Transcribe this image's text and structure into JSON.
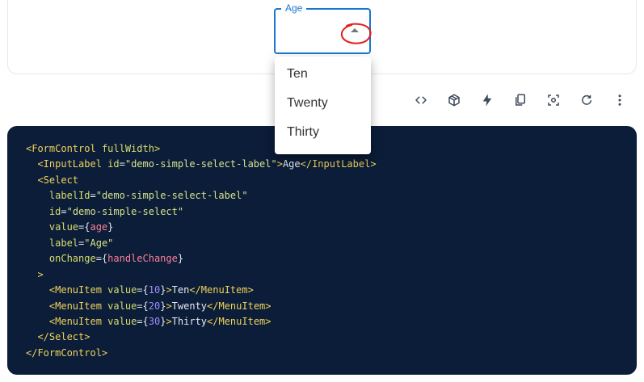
{
  "select": {
    "label": "Age",
    "options": [
      "Ten",
      "Twenty",
      "Thirty"
    ]
  },
  "toolbar": {
    "buttons": [
      {
        "name": "code-icon",
        "glyph": "<>"
      },
      {
        "name": "codesandbox-icon",
        "glyph": "cube"
      },
      {
        "name": "stackblitz-icon",
        "glyph": "bolt"
      },
      {
        "name": "copy-icon",
        "glyph": "copy"
      },
      {
        "name": "reset-focus-icon",
        "glyph": "focus"
      },
      {
        "name": "reset-demo-icon",
        "glyph": "refresh"
      },
      {
        "name": "more-options-icon",
        "glyph": "more"
      }
    ]
  },
  "code": {
    "lines": [
      [
        {
          "t": "tag",
          "v": "<FormControl"
        },
        {
          "t": "txt",
          "v": " "
        },
        {
          "t": "attr",
          "v": "fullWidth"
        },
        {
          "t": "tag",
          "v": ">"
        }
      ],
      [
        {
          "t": "txt",
          "v": "  "
        },
        {
          "t": "tag",
          "v": "<InputLabel"
        },
        {
          "t": "txt",
          "v": " "
        },
        {
          "t": "attr",
          "v": "id"
        },
        {
          "t": "punc",
          "v": "="
        },
        {
          "t": "str",
          "v": "\"demo-simple-select-label\""
        },
        {
          "t": "tag",
          "v": ">"
        },
        {
          "t": "txt",
          "v": "Age"
        },
        {
          "t": "tag",
          "v": "</InputLabel>"
        }
      ],
      [
        {
          "t": "txt",
          "v": "  "
        },
        {
          "t": "tag",
          "v": "<Select"
        }
      ],
      [
        {
          "t": "txt",
          "v": "    "
        },
        {
          "t": "attr",
          "v": "labelId"
        },
        {
          "t": "punc",
          "v": "="
        },
        {
          "t": "str",
          "v": "\"demo-simple-select-label\""
        }
      ],
      [
        {
          "t": "txt",
          "v": "    "
        },
        {
          "t": "attr",
          "v": "id"
        },
        {
          "t": "punc",
          "v": "="
        },
        {
          "t": "str",
          "v": "\"demo-simple-select\""
        }
      ],
      [
        {
          "t": "txt",
          "v": "    "
        },
        {
          "t": "attr",
          "v": "value"
        },
        {
          "t": "punc",
          "v": "={"
        },
        {
          "t": "var",
          "v": "age"
        },
        {
          "t": "punc",
          "v": "}"
        }
      ],
      [
        {
          "t": "txt",
          "v": "    "
        },
        {
          "t": "attr",
          "v": "label"
        },
        {
          "t": "punc",
          "v": "="
        },
        {
          "t": "str",
          "v": "\"Age\""
        }
      ],
      [
        {
          "t": "txt",
          "v": "    "
        },
        {
          "t": "attr",
          "v": "onChange"
        },
        {
          "t": "punc",
          "v": "={"
        },
        {
          "t": "var",
          "v": "handleChange"
        },
        {
          "t": "punc",
          "v": "}"
        }
      ],
      [
        {
          "t": "txt",
          "v": "  "
        },
        {
          "t": "tag",
          "v": ">"
        }
      ],
      [
        {
          "t": "txt",
          "v": "    "
        },
        {
          "t": "tag",
          "v": "<MenuItem"
        },
        {
          "t": "txt",
          "v": " "
        },
        {
          "t": "attr",
          "v": "value"
        },
        {
          "t": "punc",
          "v": "={"
        },
        {
          "t": "num",
          "v": "10"
        },
        {
          "t": "punc",
          "v": "}"
        },
        {
          "t": "tag",
          "v": ">"
        },
        {
          "t": "txt",
          "v": "Ten"
        },
        {
          "t": "tag",
          "v": "</MenuItem>"
        }
      ],
      [
        {
          "t": "txt",
          "v": "    "
        },
        {
          "t": "tag",
          "v": "<MenuItem"
        },
        {
          "t": "txt",
          "v": " "
        },
        {
          "t": "attr",
          "v": "value"
        },
        {
          "t": "punc",
          "v": "={"
        },
        {
          "t": "num",
          "v": "20"
        },
        {
          "t": "punc",
          "v": "}"
        },
        {
          "t": "tag",
          "v": ">"
        },
        {
          "t": "txt",
          "v": "Twenty"
        },
        {
          "t": "tag",
          "v": "</MenuItem>"
        }
      ],
      [
        {
          "t": "txt",
          "v": "    "
        },
        {
          "t": "tag",
          "v": "<MenuItem"
        },
        {
          "t": "txt",
          "v": " "
        },
        {
          "t": "attr",
          "v": "value"
        },
        {
          "t": "punc",
          "v": "={"
        },
        {
          "t": "num",
          "v": "30"
        },
        {
          "t": "punc",
          "v": "}"
        },
        {
          "t": "tag",
          "v": ">"
        },
        {
          "t": "txt",
          "v": "Thirty"
        },
        {
          "t": "tag",
          "v": "</MenuItem>"
        }
      ],
      [
        {
          "t": "txt",
          "v": "  "
        },
        {
          "t": "tag",
          "v": "</Select>"
        }
      ],
      [
        {
          "t": "tag",
          "v": "</FormControl>"
        }
      ]
    ]
  },
  "colors": {
    "accent": "#1976d2",
    "code_bg": "#0b1d38",
    "annotation": "#e0201a"
  }
}
